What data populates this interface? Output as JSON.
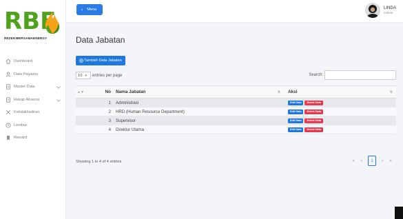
{
  "brand": {
    "logo_text": "RBE",
    "tagline": "REZEKIBERSAMAENERGY",
    "colors": {
      "logo_green": "#4ea21c",
      "flame_orange": "#f6a21a",
      "accent_blue": "#1f78e0",
      "danger_red": "#e53950"
    }
  },
  "sidebar": {
    "items": [
      {
        "label": "Dashboard",
        "icon": "home-icon",
        "has_submenu": false
      },
      {
        "label": "Data Pegawai",
        "icon": "user-icon",
        "has_submenu": false
      },
      {
        "label": "Master Data",
        "icon": "document-icon",
        "has_submenu": true
      },
      {
        "label": "Rekap Absensi",
        "icon": "document-icon",
        "has_submenu": true
      },
      {
        "label": "Ketidakhadiran",
        "icon": "x-person-icon",
        "has_submenu": false
      },
      {
        "label": "Lembur",
        "icon": "clock-icon",
        "has_submenu": false
      },
      {
        "label": "Reward",
        "icon": "award-icon",
        "has_submenu": false
      }
    ]
  },
  "header": {
    "menu_label": "Menu",
    "user_name": "LINDA",
    "user_role": "Admin"
  },
  "main": {
    "title": "Data Jabatan",
    "add_button": "Tambah Data Jabatan",
    "length_value": "10",
    "length_suffix": "entries per page",
    "search_label": "Search:",
    "search_value": "",
    "table": {
      "columns": [
        "No",
        "Nama Jabatan",
        "Aksi"
      ],
      "rows": [
        {
          "no": "1",
          "name": "Administrasi"
        },
        {
          "no": "2",
          "name": "HRD (Human Resource Department)"
        },
        {
          "no": "3",
          "name": "Supervisor"
        },
        {
          "no": "4",
          "name": "Direktur Utama"
        }
      ],
      "edit_label": "Edit Data",
      "delete_label": "Delete Data"
    },
    "info": "Showing 1 to 4 of 4 entries",
    "pager": {
      "first": "«",
      "prev": "‹",
      "current": "1",
      "next": "›",
      "last": "»"
    }
  }
}
